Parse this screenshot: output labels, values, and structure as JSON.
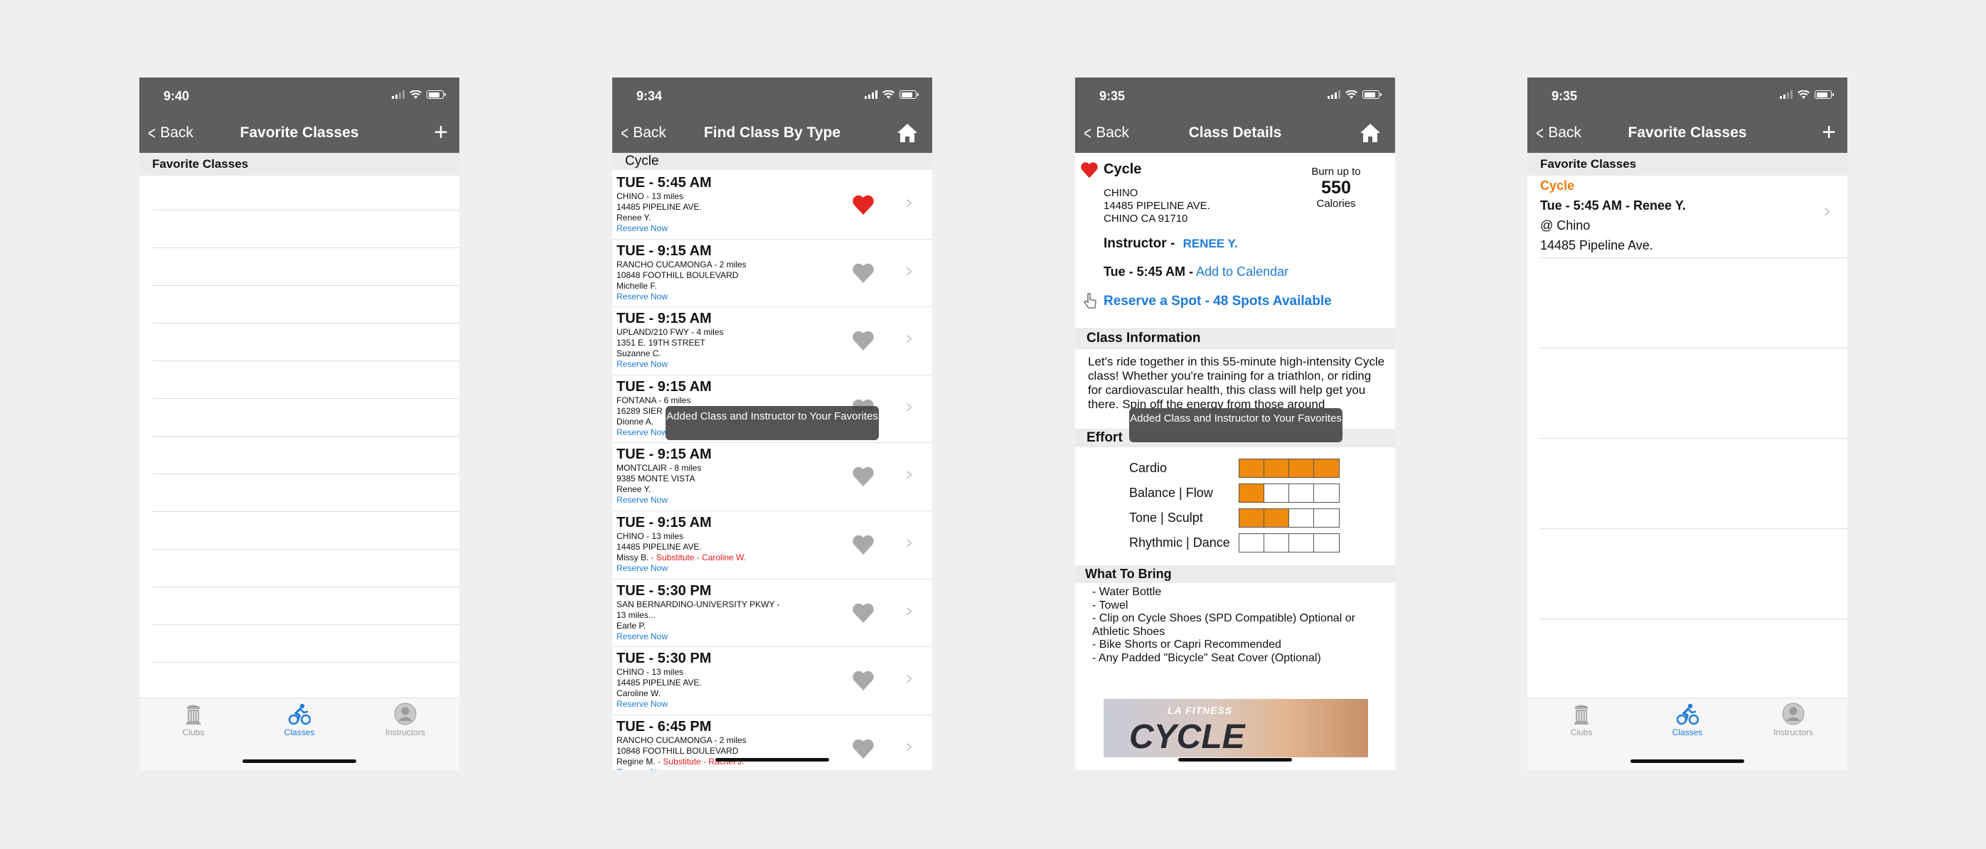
{
  "screens": [
    {
      "time": "9:40",
      "back": "Back",
      "title": "Favorite Classes",
      "action": "+",
      "section": "Favorite Classes",
      "tabs": [
        "Clubs",
        "Classes",
        "Instructors"
      ]
    },
    {
      "time": "9:34",
      "back": "Back",
      "title": "Find Class By Type",
      "section": "Cycle",
      "reserve_label": "Reserve Now",
      "toast": "Added Class and Instructor to Your Favorites",
      "classes": [
        {
          "time": "TUE - 5:45 AM",
          "loc": "CHINO - 13 miles",
          "addr": "14485 PIPELINE AVE.",
          "instr": "Renee Y.",
          "sub": "",
          "favorite": true
        },
        {
          "time": "TUE - 9:15 AM",
          "loc": "RANCHO CUCAMONGA - 2 miles",
          "addr": "10848 FOOTHILL BOULEVARD",
          "instr": "Michelle F.",
          "sub": "",
          "favorite": false
        },
        {
          "time": "TUE - 9:15 AM",
          "loc": "UPLAND/210 FWY - 4 miles",
          "addr": "1351 E. 19TH STREET",
          "instr": "Suzanne C.",
          "sub": "",
          "favorite": false
        },
        {
          "time": "TUE - 9:15 AM",
          "loc": "FONTANA - 6 miles",
          "addr": "16289 SIER",
          "instr": "Dionne A.",
          "sub": "",
          "favorite": false
        },
        {
          "time": "TUE - 9:15 AM",
          "loc": "MONTCLAIR - 8 miles",
          "addr": "9385 MONTE VISTA",
          "instr": "Renee Y.",
          "sub": "",
          "favorite": false
        },
        {
          "time": "TUE - 9:15 AM",
          "loc": "CHINO - 13 miles",
          "addr": "14485 PIPELINE AVE.",
          "instr": "Missy B.",
          "sub": " - Substitute - Caroline W.",
          "favorite": false
        },
        {
          "time": "TUE - 5:30 PM",
          "loc": "SAN BERNARDINO-UNIVERSITY PKWY -",
          "addr": "13 miles...",
          "instr": "Earle P.",
          "sub": "",
          "favorite": false
        },
        {
          "time": "TUE - 5:30 PM",
          "loc": "CHINO - 13 miles",
          "addr": "14485 PIPELINE AVE.",
          "instr": "Caroline W.",
          "sub": "",
          "favorite": false
        },
        {
          "time": "TUE - 6:45 PM",
          "loc": "RANCHO CUCAMONGA - 2 miles",
          "addr": "10848 FOOTHILL BOULEVARD",
          "instr": "Regine M.",
          "sub": " - Substitute - Rachel J.",
          "favorite": false
        }
      ]
    },
    {
      "time": "9:35",
      "back": "Back",
      "title": "Class Details",
      "class_name": "Cycle",
      "burn_label": "Burn up to",
      "calories": "550",
      "cal_unit": "Calories",
      "club": "CHINO",
      "addr1": "14485 PIPELINE AVE.",
      "addr2": "CHINO CA 91710",
      "instructor_label": "Instructor -",
      "instructor": "RENEE Y.",
      "when": "Tue - 5:45 AM -",
      "calendar": "Add to Calendar",
      "reserve": "Reserve a Spot - 48 Spots Available",
      "info_head": "Class Information",
      "info_text": "Let's ride together in this 55-minute high-intensity Cycle class! Whether you're training for a triathlon, or riding for cardiovascular health, this class will help get you there. Spin off the energy from those around",
      "toast": "Added Class and Instructor to Your Favorites",
      "effort_head": "Effort",
      "effort": [
        {
          "name": "Cardio",
          "level": 4
        },
        {
          "name": "Balance | Flow",
          "level": 1
        },
        {
          "name": "Tone | Sculpt",
          "level": 2
        },
        {
          "name": "Rhythmic | Dance",
          "level": 0
        }
      ],
      "bring_head": "What To Bring",
      "bring": [
        " - Water Bottle",
        " -  Towel",
        "- Clip on Cycle Shoes (SPD Compatible) Optional or Athletic Shoes",
        "- Bike Shorts or Capri Recommended",
        "- Any Padded \"Bicycle\" Seat Cover (Optional)"
      ],
      "banner_brand": "LA FITNESS",
      "banner_title": "CYCLE"
    },
    {
      "time": "9:35",
      "back": "Back",
      "title": "Favorite Classes",
      "action": "+",
      "section": "Favorite Classes",
      "fav": {
        "type": "Cycle",
        "when": "Tue - 5:45 AM - Renee Y.",
        "club": "@ Chino",
        "addr": "14485 Pipeline Ave."
      },
      "tabs": [
        "Clubs",
        "Classes",
        "Instructors"
      ]
    }
  ],
  "colors": {
    "header": "#5e5e5e",
    "accent": "#1e7bd9",
    "heart": "#e52521",
    "effort": "#f08a0c",
    "fav_type": "#f07a10"
  }
}
